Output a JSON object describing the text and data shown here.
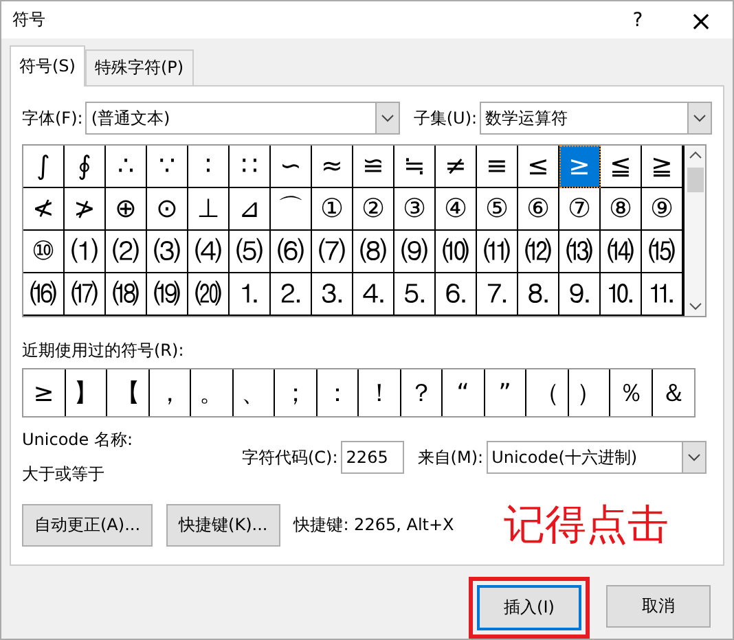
{
  "window": {
    "title": "符号",
    "help": "?",
    "close": "×"
  },
  "tabs": [
    {
      "label": "符号(S)",
      "selected": true
    },
    {
      "label": "特殊字符(P)",
      "selected": false
    }
  ],
  "font": {
    "label": "字体(F):",
    "value": "(普通文本)"
  },
  "subset": {
    "label": "子集(U):",
    "value": "数学运算符"
  },
  "symbols": [
    {
      "char": "∫",
      "selected": false
    },
    {
      "char": "∮",
      "selected": false
    },
    {
      "char": "∴",
      "selected": false
    },
    {
      "char": "∵",
      "selected": false
    },
    {
      "char": "∶",
      "selected": false
    },
    {
      "char": "∷",
      "selected": false
    },
    {
      "char": "∽",
      "selected": false
    },
    {
      "char": "≈",
      "selected": false
    },
    {
      "char": "≌",
      "selected": false
    },
    {
      "char": "≒",
      "selected": false
    },
    {
      "char": "≠",
      "selected": false
    },
    {
      "char": "≡",
      "selected": false
    },
    {
      "char": "≤",
      "selected": false
    },
    {
      "char": "≥",
      "selected": true
    },
    {
      "char": "≦",
      "selected": false
    },
    {
      "char": "≧",
      "selected": false
    },
    {
      "char": "≮",
      "selected": false
    },
    {
      "char": "≯",
      "selected": false
    },
    {
      "char": "⊕",
      "selected": false
    },
    {
      "char": "⊙",
      "selected": false
    },
    {
      "char": "⊥",
      "selected": false
    },
    {
      "char": "⊿",
      "selected": false
    },
    {
      "char": "⌒",
      "selected": false
    },
    {
      "char": "①",
      "selected": false
    },
    {
      "char": "②",
      "selected": false
    },
    {
      "char": "③",
      "selected": false
    },
    {
      "char": "④",
      "selected": false
    },
    {
      "char": "⑤",
      "selected": false
    },
    {
      "char": "⑥",
      "selected": false
    },
    {
      "char": "⑦",
      "selected": false
    },
    {
      "char": "⑧",
      "selected": false
    },
    {
      "char": "⑨",
      "selected": false
    },
    {
      "char": "⑩",
      "selected": false
    },
    {
      "char": "⑴",
      "selected": false
    },
    {
      "char": "⑵",
      "selected": false
    },
    {
      "char": "⑶",
      "selected": false
    },
    {
      "char": "⑷",
      "selected": false
    },
    {
      "char": "⑸",
      "selected": false
    },
    {
      "char": "⑹",
      "selected": false
    },
    {
      "char": "⑺",
      "selected": false
    },
    {
      "char": "⑻",
      "selected": false
    },
    {
      "char": "⑼",
      "selected": false
    },
    {
      "char": "⑽",
      "selected": false
    },
    {
      "char": "⑾",
      "selected": false
    },
    {
      "char": "⑿",
      "selected": false
    },
    {
      "char": "⒀",
      "selected": false
    },
    {
      "char": "⒁",
      "selected": false
    },
    {
      "char": "⒂",
      "selected": false
    },
    {
      "char": "⒃",
      "selected": false
    },
    {
      "char": "⒄",
      "selected": false
    },
    {
      "char": "⒅",
      "selected": false
    },
    {
      "char": "⒆",
      "selected": false
    },
    {
      "char": "⒇",
      "selected": false
    },
    {
      "char": "⒈",
      "selected": false
    },
    {
      "char": "⒉",
      "selected": false
    },
    {
      "char": "⒊",
      "selected": false
    },
    {
      "char": "⒋",
      "selected": false
    },
    {
      "char": "⒌",
      "selected": false
    },
    {
      "char": "⒍",
      "selected": false
    },
    {
      "char": "⒎",
      "selected": false
    },
    {
      "char": "⒏",
      "selected": false
    },
    {
      "char": "⒐",
      "selected": false
    },
    {
      "char": "⒑",
      "selected": false
    },
    {
      "char": "⒒",
      "selected": false
    }
  ],
  "recent": {
    "label": "近期使用过的符号(R):",
    "symbols": [
      "≥",
      "】",
      "【",
      "，",
      "。",
      "、",
      "；",
      "：",
      "！",
      "？",
      "“",
      "”",
      "（",
      "）",
      "％",
      "＆"
    ]
  },
  "unicode_name": {
    "label": "Unicode 名称:",
    "value": "大于或等于"
  },
  "char_code": {
    "label": "字符代码(C):",
    "value": "2265"
  },
  "from": {
    "label": "来自(M):",
    "value": "Unicode(十六进制)"
  },
  "tool_buttons": [
    "自动更正(A)...",
    "快捷键(K)..."
  ],
  "shortcut": "快捷键: 2265, Alt+X",
  "annotation": "记得点击",
  "buttons": [
    {
      "label": "插入(I)",
      "kind": "default",
      "highlighted": true
    },
    {
      "label": "取消",
      "kind": "normal",
      "highlighted": false
    }
  ]
}
